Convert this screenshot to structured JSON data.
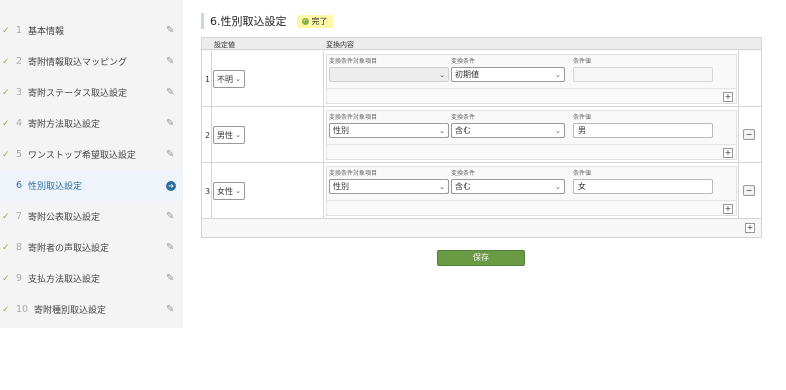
{
  "sidebar": {
    "items": [
      {
        "num": "1",
        "label": "基本情報",
        "state": "done"
      },
      {
        "num": "2",
        "label": "寄附情報取込マッピング",
        "state": "done"
      },
      {
        "num": "3",
        "label": "寄附ステータス取込設定",
        "state": "done"
      },
      {
        "num": "4",
        "label": "寄附方法取込設定",
        "state": "done"
      },
      {
        "num": "5",
        "label": "ワンストップ希望取込設定",
        "state": "done"
      },
      {
        "num": "6",
        "label": "性別取込設定",
        "state": "active"
      },
      {
        "num": "7",
        "label": "寄附公表取込設定",
        "state": "done"
      },
      {
        "num": "8",
        "label": "寄附者の声取込設定",
        "state": "done"
      },
      {
        "num": "9",
        "label": "支払方法取込設定",
        "state": "done"
      },
      {
        "num": "10",
        "label": "寄附種別取込設定",
        "state": "done"
      }
    ],
    "check_glyph": "✓",
    "edit_icon": "pencil-icon",
    "go_icon": "arrow-circle-icon"
  },
  "main": {
    "title": "6.性別取込設定",
    "status_badge": "完了",
    "table": {
      "col_setting": "設定値",
      "col_conversion": "変換内容",
      "sub_target": "変換条件対象項目",
      "sub_condition": "変換条件",
      "sub_value": "条件値",
      "rows": [
        {
          "index": "1",
          "setting": "不明",
          "target": "",
          "condition": "初期値",
          "value": "",
          "removable": false
        },
        {
          "index": "2",
          "setting": "男性",
          "target": "性別",
          "condition": "含む",
          "value": "男",
          "removable": true
        },
        {
          "index": "3",
          "setting": "女性",
          "target": "性別",
          "condition": "含む",
          "value": "女",
          "removable": true
        }
      ]
    },
    "add_label": "+",
    "remove_label": "−",
    "save_label": "保存"
  },
  "colors": {
    "accent": "#2e6da4",
    "save": "#6b9a45",
    "badge": "#fff7a8",
    "check": "#8ab04a"
  }
}
